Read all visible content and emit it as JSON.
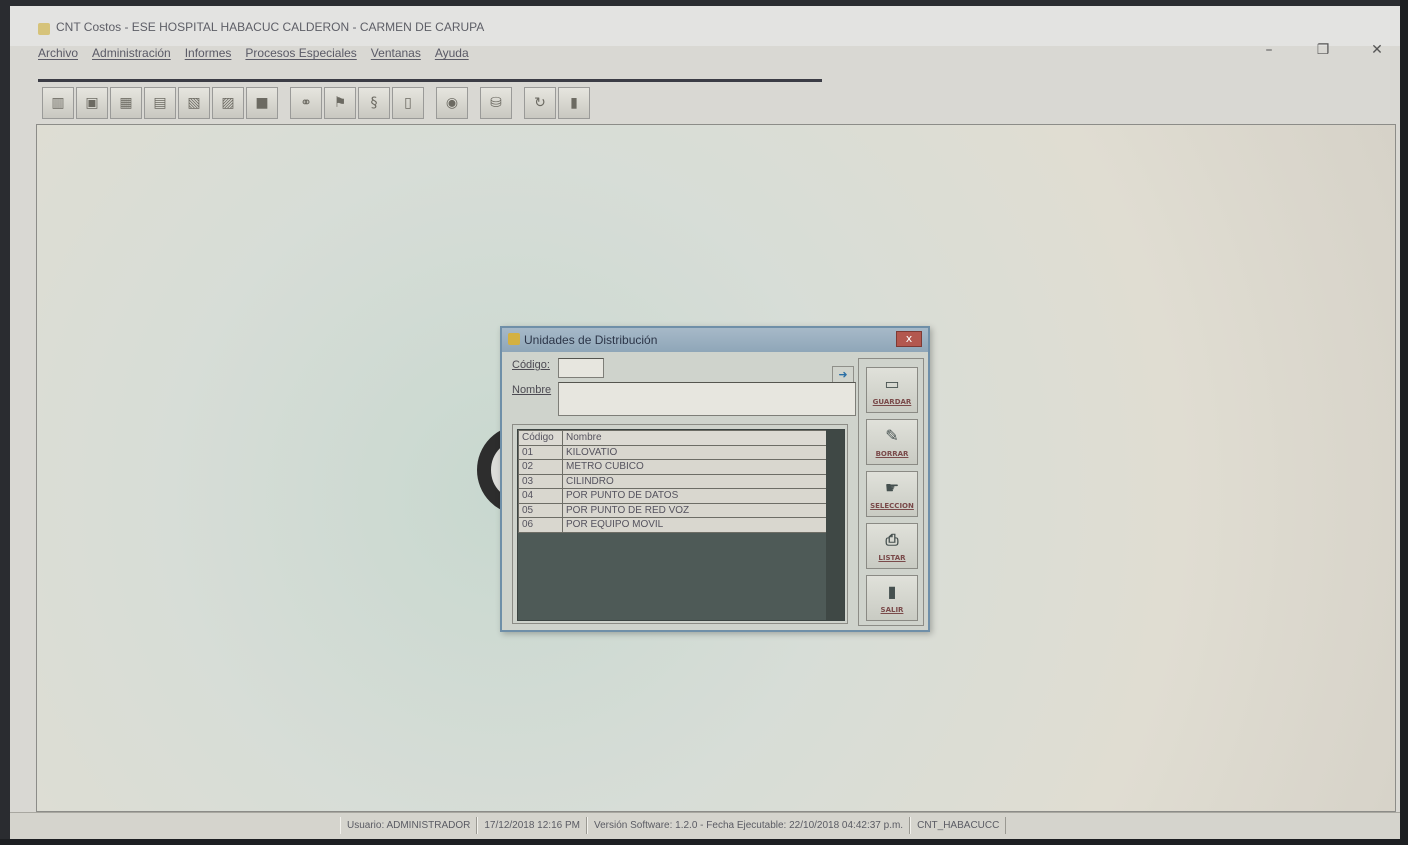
{
  "window": {
    "title": "CNT Costos - ESE HOSPITAL HABACUC CALDERON - CARMEN DE CARUPA",
    "minimize": "–",
    "restore": "❐",
    "close": "✕"
  },
  "menu": [
    "Archivo",
    "Administración",
    "Informes",
    "Procesos Especiales",
    "Ventanas",
    "Ayuda"
  ],
  "toolbar": {
    "icons": [
      "book-icon",
      "box-icon",
      "grid-icon",
      "table-icon",
      "page-icon",
      "folder-icon",
      "package-icon",
      "link-icon",
      "flag-icon",
      "coil-icon",
      "document-icon",
      "search-icon",
      "database-icon",
      "refresh-icon",
      "door-icon"
    ]
  },
  "dialog": {
    "title": "Unidades de Distribución",
    "close_label": "x",
    "codigo_label": "Código:",
    "nombre_label": "Nombre",
    "codigo_value": "",
    "nombre_value": "",
    "columns": [
      "Código",
      "Nombre"
    ],
    "rows": [
      {
        "codigo": "01",
        "nombre": "KILOVATIO"
      },
      {
        "codigo": "02",
        "nombre": "METRO CUBICO"
      },
      {
        "codigo": "03",
        "nombre": "CILINDRO"
      },
      {
        "codigo": "04",
        "nombre": "POR PUNTO DE DATOS"
      },
      {
        "codigo": "05",
        "nombre": "POR PUNTO DE RED VOZ"
      },
      {
        "codigo": "06",
        "nombre": "POR EQUIPO MOVIL"
      }
    ],
    "buttons": {
      "guardar": "GUARDAR",
      "borrar": "BORRAR",
      "seleccion": "SELECCION",
      "listar": "LISTAR",
      "salir": "SALIR"
    }
  },
  "status": {
    "usuario": "Usuario: ADMINISTRADOR",
    "fecha": "17/12/2018 12:16 PM",
    "version": "Versión Software: 1.2.0 - Fecha Ejecutable: 22/10/2018 04:42:37 p.m.",
    "db": "CNT_HABACUCC"
  }
}
